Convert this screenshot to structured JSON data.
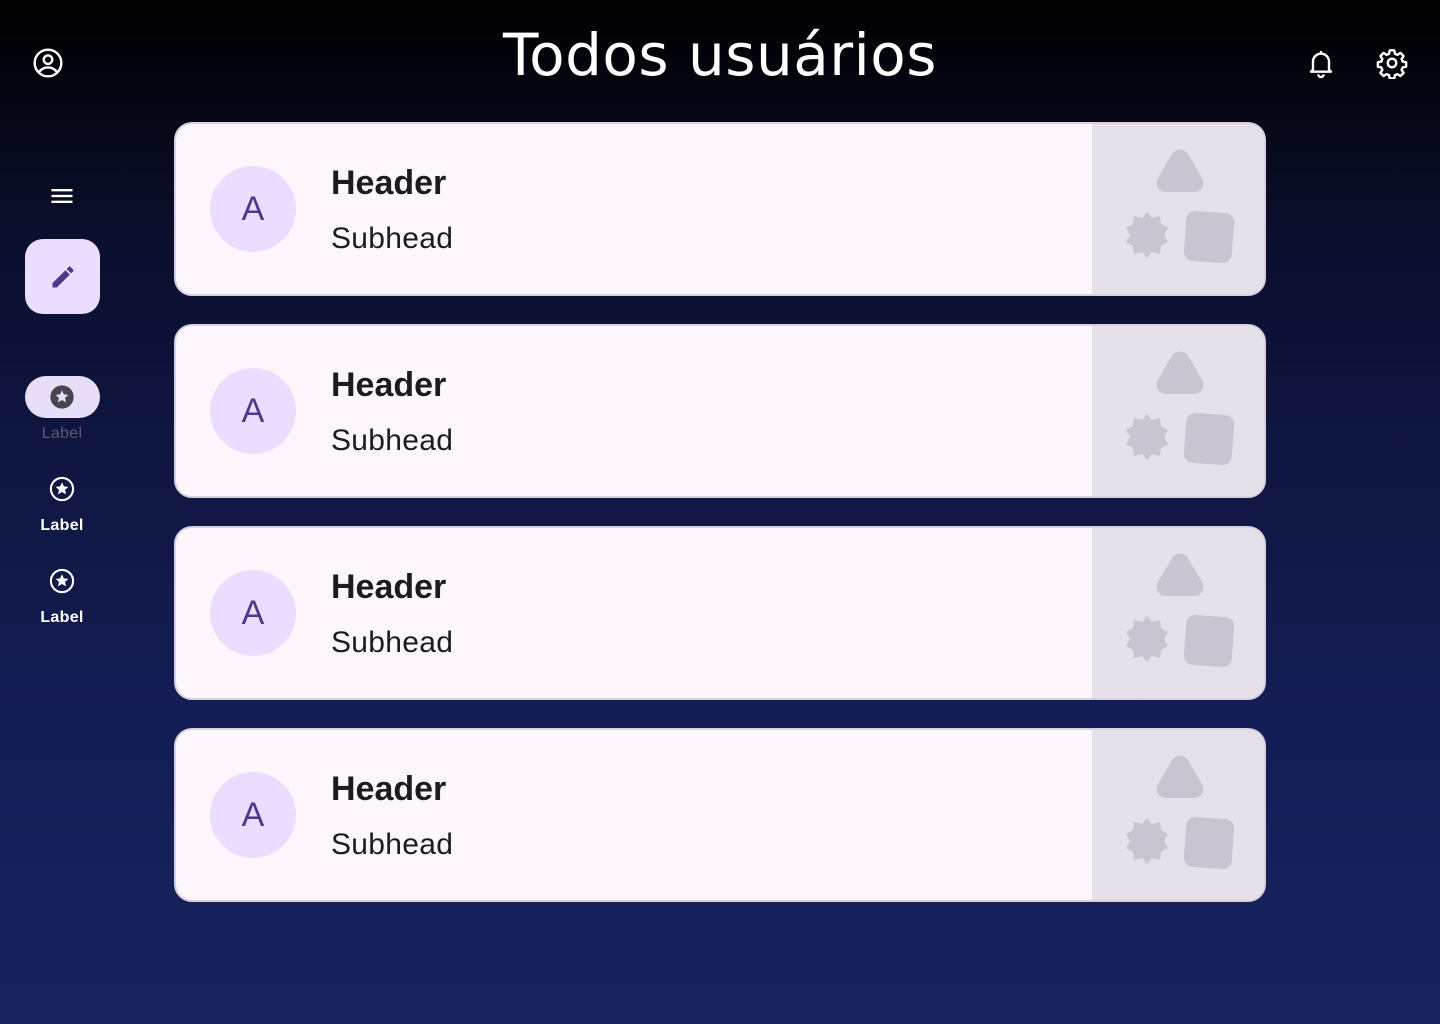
{
  "page": {
    "title": "Todos usuários"
  },
  "topbar": {
    "account_icon": "account-circle-icon",
    "notification_icon": "bell-icon",
    "settings_icon": "gear-icon"
  },
  "rail": {
    "menu_icon": "hamburger-menu-icon",
    "fab_icon": "pencil-icon",
    "items": [
      {
        "label": "Label",
        "icon": "star-circle-icon",
        "active": true
      },
      {
        "label": "Label",
        "icon": "star-circle-icon",
        "active": false
      },
      {
        "label": "Label",
        "icon": "star-circle-icon",
        "active": false
      }
    ]
  },
  "cards": [
    {
      "avatar": "A",
      "header": "Header",
      "subhead": "Subhead",
      "media_icon": "shapes-placeholder-icon"
    },
    {
      "avatar": "A",
      "header": "Header",
      "subhead": "Subhead",
      "media_icon": "shapes-placeholder-icon"
    },
    {
      "avatar": "A",
      "header": "Header",
      "subhead": "Subhead",
      "media_icon": "shapes-placeholder-icon"
    },
    {
      "avatar": "A",
      "header": "Header",
      "subhead": "Subhead",
      "media_icon": "shapes-placeholder-icon"
    }
  ],
  "colors": {
    "background_top": "#000000",
    "background_bottom": "#17225f",
    "card_surface": "#fdf7fd",
    "avatar_bg": "#eaddff",
    "avatar_text": "#4f378b",
    "media_bg": "#e6e0e9",
    "placeholder_shape": "#cac4d0"
  }
}
